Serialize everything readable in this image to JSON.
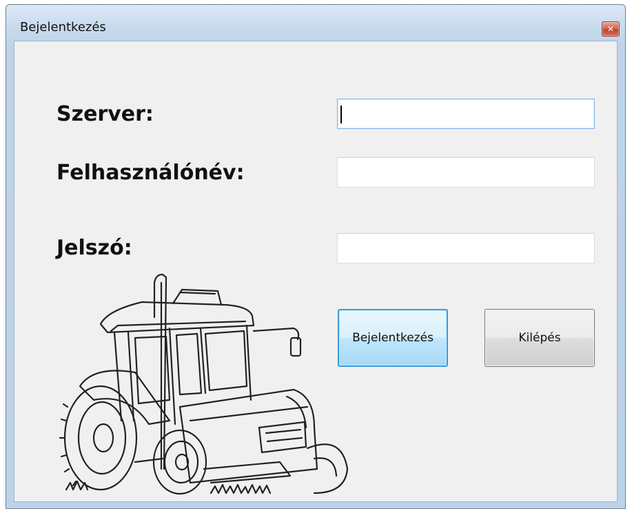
{
  "window": {
    "title": "Bejelentkezés",
    "close_icon": "close-icon"
  },
  "form": {
    "server_label": "Szerver:",
    "server_value": "",
    "username_label": "Felhasználónév:",
    "username_value": "",
    "password_label": "Jelszó:",
    "password_value": ""
  },
  "buttons": {
    "login_label": "Bejelentkezés",
    "exit_label": "Kilépés"
  },
  "image": {
    "icon": "tractor-illustration"
  },
  "colors": {
    "title_bar": "#c9dcee",
    "client_bg": "#f0f0f0",
    "focus_border": "#3c9ad8",
    "close_button": "#c0432a"
  }
}
